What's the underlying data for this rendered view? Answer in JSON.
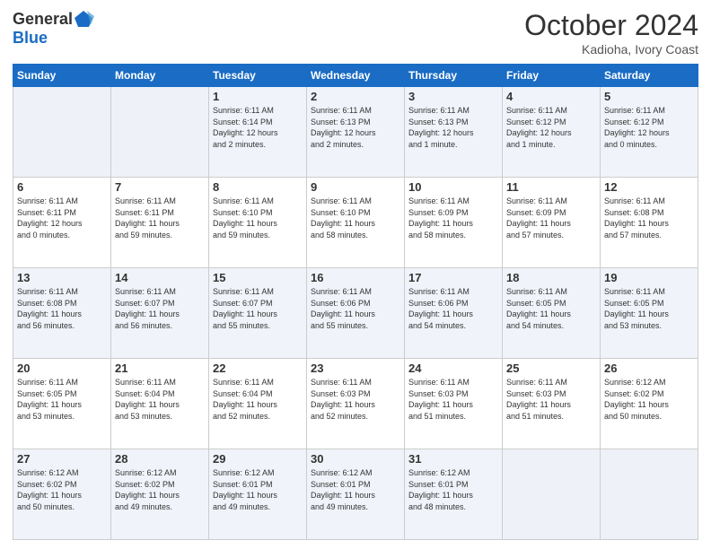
{
  "header": {
    "logo_general": "General",
    "logo_blue": "Blue",
    "month_title": "October 2024",
    "location": "Kadioha, Ivory Coast"
  },
  "weekdays": [
    "Sunday",
    "Monday",
    "Tuesday",
    "Wednesday",
    "Thursday",
    "Friday",
    "Saturday"
  ],
  "weeks": [
    [
      {
        "day": "",
        "info": ""
      },
      {
        "day": "",
        "info": ""
      },
      {
        "day": "1",
        "info": "Sunrise: 6:11 AM\nSunset: 6:14 PM\nDaylight: 12 hours\nand 2 minutes."
      },
      {
        "day": "2",
        "info": "Sunrise: 6:11 AM\nSunset: 6:13 PM\nDaylight: 12 hours\nand 2 minutes."
      },
      {
        "day": "3",
        "info": "Sunrise: 6:11 AM\nSunset: 6:13 PM\nDaylight: 12 hours\nand 1 minute."
      },
      {
        "day": "4",
        "info": "Sunrise: 6:11 AM\nSunset: 6:12 PM\nDaylight: 12 hours\nand 1 minute."
      },
      {
        "day": "5",
        "info": "Sunrise: 6:11 AM\nSunset: 6:12 PM\nDaylight: 12 hours\nand 0 minutes."
      }
    ],
    [
      {
        "day": "6",
        "info": "Sunrise: 6:11 AM\nSunset: 6:11 PM\nDaylight: 12 hours\nand 0 minutes."
      },
      {
        "day": "7",
        "info": "Sunrise: 6:11 AM\nSunset: 6:11 PM\nDaylight: 11 hours\nand 59 minutes."
      },
      {
        "day": "8",
        "info": "Sunrise: 6:11 AM\nSunset: 6:10 PM\nDaylight: 11 hours\nand 59 minutes."
      },
      {
        "day": "9",
        "info": "Sunrise: 6:11 AM\nSunset: 6:10 PM\nDaylight: 11 hours\nand 58 minutes."
      },
      {
        "day": "10",
        "info": "Sunrise: 6:11 AM\nSunset: 6:09 PM\nDaylight: 11 hours\nand 58 minutes."
      },
      {
        "day": "11",
        "info": "Sunrise: 6:11 AM\nSunset: 6:09 PM\nDaylight: 11 hours\nand 57 minutes."
      },
      {
        "day": "12",
        "info": "Sunrise: 6:11 AM\nSunset: 6:08 PM\nDaylight: 11 hours\nand 57 minutes."
      }
    ],
    [
      {
        "day": "13",
        "info": "Sunrise: 6:11 AM\nSunset: 6:08 PM\nDaylight: 11 hours\nand 56 minutes."
      },
      {
        "day": "14",
        "info": "Sunrise: 6:11 AM\nSunset: 6:07 PM\nDaylight: 11 hours\nand 56 minutes."
      },
      {
        "day": "15",
        "info": "Sunrise: 6:11 AM\nSunset: 6:07 PM\nDaylight: 11 hours\nand 55 minutes."
      },
      {
        "day": "16",
        "info": "Sunrise: 6:11 AM\nSunset: 6:06 PM\nDaylight: 11 hours\nand 55 minutes."
      },
      {
        "day": "17",
        "info": "Sunrise: 6:11 AM\nSunset: 6:06 PM\nDaylight: 11 hours\nand 54 minutes."
      },
      {
        "day": "18",
        "info": "Sunrise: 6:11 AM\nSunset: 6:05 PM\nDaylight: 11 hours\nand 54 minutes."
      },
      {
        "day": "19",
        "info": "Sunrise: 6:11 AM\nSunset: 6:05 PM\nDaylight: 11 hours\nand 53 minutes."
      }
    ],
    [
      {
        "day": "20",
        "info": "Sunrise: 6:11 AM\nSunset: 6:05 PM\nDaylight: 11 hours\nand 53 minutes."
      },
      {
        "day": "21",
        "info": "Sunrise: 6:11 AM\nSunset: 6:04 PM\nDaylight: 11 hours\nand 53 minutes."
      },
      {
        "day": "22",
        "info": "Sunrise: 6:11 AM\nSunset: 6:04 PM\nDaylight: 11 hours\nand 52 minutes."
      },
      {
        "day": "23",
        "info": "Sunrise: 6:11 AM\nSunset: 6:03 PM\nDaylight: 11 hours\nand 52 minutes."
      },
      {
        "day": "24",
        "info": "Sunrise: 6:11 AM\nSunset: 6:03 PM\nDaylight: 11 hours\nand 51 minutes."
      },
      {
        "day": "25",
        "info": "Sunrise: 6:11 AM\nSunset: 6:03 PM\nDaylight: 11 hours\nand 51 minutes."
      },
      {
        "day": "26",
        "info": "Sunrise: 6:12 AM\nSunset: 6:02 PM\nDaylight: 11 hours\nand 50 minutes."
      }
    ],
    [
      {
        "day": "27",
        "info": "Sunrise: 6:12 AM\nSunset: 6:02 PM\nDaylight: 11 hours\nand 50 minutes."
      },
      {
        "day": "28",
        "info": "Sunrise: 6:12 AM\nSunset: 6:02 PM\nDaylight: 11 hours\nand 49 minutes."
      },
      {
        "day": "29",
        "info": "Sunrise: 6:12 AM\nSunset: 6:01 PM\nDaylight: 11 hours\nand 49 minutes."
      },
      {
        "day": "30",
        "info": "Sunrise: 6:12 AM\nSunset: 6:01 PM\nDaylight: 11 hours\nand 49 minutes."
      },
      {
        "day": "31",
        "info": "Sunrise: 6:12 AM\nSunset: 6:01 PM\nDaylight: 11 hours\nand 48 minutes."
      },
      {
        "day": "",
        "info": ""
      },
      {
        "day": "",
        "info": ""
      }
    ]
  ]
}
